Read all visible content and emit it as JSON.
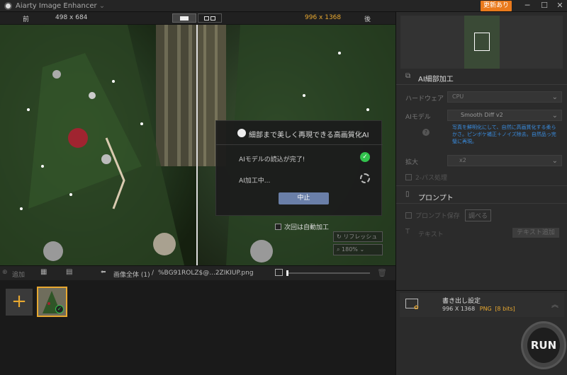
{
  "app": {
    "title": "Aiarty Image Enhancer",
    "update_button": "更新あり",
    "controls": [
      "─",
      "☐",
      "✕"
    ]
  },
  "info": {
    "before_label": "前",
    "before_size": "498 x 684",
    "after_size": "996 x 1368",
    "after_label": "後"
  },
  "dialog": {
    "title": "細部まで美しく再現できる高画質化AI",
    "step1": "AIモデルの読込が完了!",
    "step2": "AI加工中...",
    "stop_button": "中止",
    "auto_process": "次回は自動加工"
  },
  "overlay": {
    "refresh": "リフレッシュ",
    "zoom": "180%"
  },
  "bottombar": {
    "add": "追加",
    "all_images": "画像全体 (1)",
    "separator": "/",
    "filename": "%BG91ROLZ$@...2ZIKIUP.png"
  },
  "side": {
    "section_title": "AI細部加工",
    "hardware_label": "ハードウェア",
    "hardware_value": "CPU",
    "model_label": "AIモデル",
    "model_value": "Smooth Diff v2",
    "model_desc": "写真を鮮明化にして、自然に高画質化する柔らかさ。ピンボケ補正＋ノイズ除去。自然品っ完璧に再現。",
    "scale_label": "拡大",
    "scale_value": "x2",
    "two_pass": "2-パス処理",
    "prompt_title": "プロンプト",
    "prompt_save": "プロンプト保存",
    "prompt_view": "調べる",
    "text_label": "テキスト",
    "text_add": "テキスト追加",
    "export_title": "書き出し設定",
    "export_size": "996 X 1368",
    "export_format": "PNG",
    "export_bits": "[8 bits]",
    "run": "RUN"
  },
  "colors": {
    "accent": "#ea7a1c",
    "format": "#e8a830",
    "desc": "#3a8de0",
    "ok": "#32c24d"
  }
}
